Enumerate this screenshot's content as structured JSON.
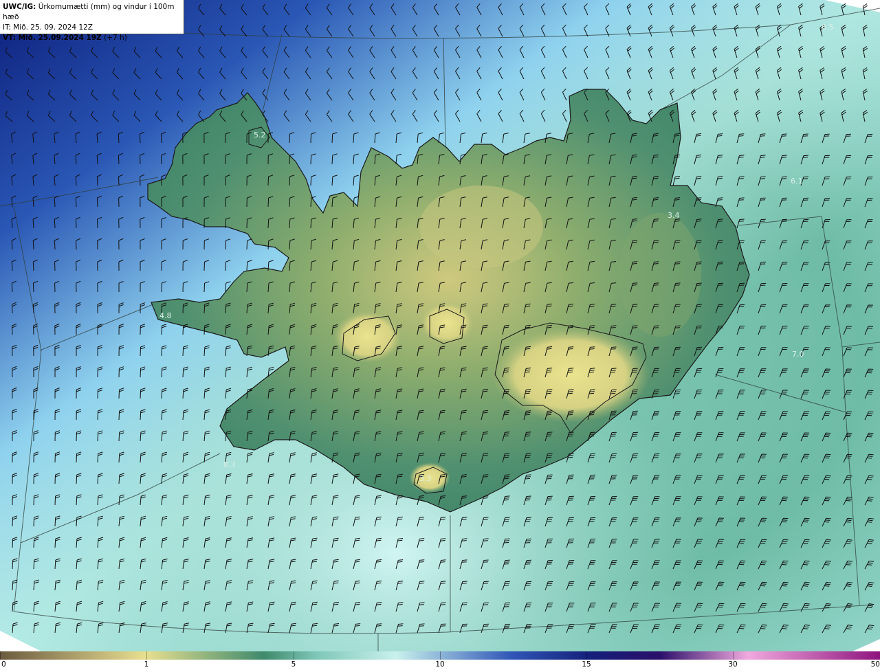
{
  "header": {
    "prefix": "UWC/IG:",
    "title": "Úrkomumætti (mm) og vindur í 100m hæð",
    "init_time": "IT: Mið. 25. 09. 2024 12Z",
    "valid_prefix": "VT: Mið. 25.09.2024 19Z",
    "valid_suffix": "(+7 h)"
  },
  "map_labels": [
    {
      "name": "label-north-east-sea",
      "text": "6.5"
    },
    {
      "name": "label-westfjords",
      "text": "5.2"
    },
    {
      "name": "label-east-sea",
      "text": "6.1"
    },
    {
      "name": "label-east-fjords",
      "text": "3.4"
    },
    {
      "name": "label-snaefellsnes",
      "text": "4.8"
    },
    {
      "name": "label-south-east-sea",
      "text": "7.0"
    },
    {
      "name": "label-south-west-sea",
      "text": "8.3"
    },
    {
      "name": "label-south-coast",
      "text": "3.3"
    }
  ],
  "colorbar": {
    "ticks": [
      "0",
      "1",
      "5",
      "10",
      "15",
      "30",
      "50"
    ],
    "colors": [
      "#6b5a3e",
      "#a99b69",
      "#e8df8f",
      "#3f8a6c",
      "#7fc7b8",
      "#c9f1ec",
      "#3157b8",
      "#14207a",
      "#2b0f6a",
      "#f1a9de",
      "#8e137d"
    ]
  }
}
